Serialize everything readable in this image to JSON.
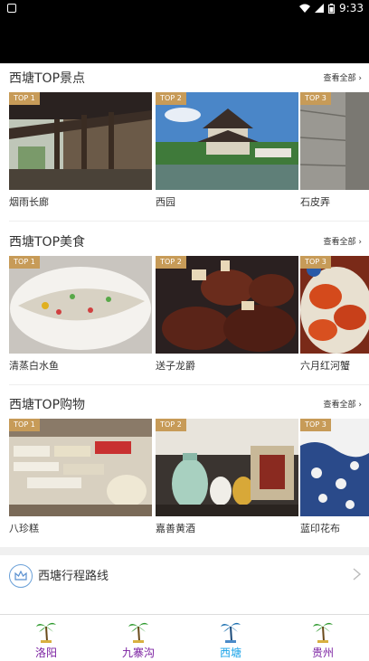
{
  "status_bar": {
    "time": "9:33"
  },
  "sections": [
    {
      "title": "西塘TOP景点",
      "more": "查看全部",
      "cards": [
        {
          "badge": "TOP 1",
          "label": "烟雨长廊"
        },
        {
          "badge": "TOP 2",
          "label": "西园"
        },
        {
          "badge": "TOP 3",
          "label": "石皮弄"
        }
      ]
    },
    {
      "title": "西塘TOP美食",
      "more": "查看全部",
      "cards": [
        {
          "badge": "TOP 1",
          "label": "清蒸白水鱼"
        },
        {
          "badge": "TOP 2",
          "label": "送子龙爵"
        },
        {
          "badge": "TOP 3",
          "label": "六月红河蟹"
        }
      ]
    },
    {
      "title": "西塘TOP购物",
      "more": "查看全部",
      "cards": [
        {
          "badge": "TOP 1",
          "label": "八珍糕"
        },
        {
          "badge": "TOP 2",
          "label": "嘉善黄酒"
        },
        {
          "badge": "TOP 3",
          "label": "蓝印花布"
        }
      ]
    }
  ],
  "route": {
    "label": "西塘行程路线"
  },
  "bottom_nav": [
    {
      "label": "洛阳",
      "color": "#7a1fa0",
      "active": false
    },
    {
      "label": "九寨沟",
      "color": "#7a1fa0",
      "active": false
    },
    {
      "label": "西塘",
      "color": "#1aa3e8",
      "active": true
    },
    {
      "label": "贵州",
      "color": "#7a1fa0",
      "active": false
    }
  ],
  "colors": {
    "badge": "#c79b58",
    "palm_green": "#2e9a2e",
    "palm_active": "#1a6fb0"
  }
}
